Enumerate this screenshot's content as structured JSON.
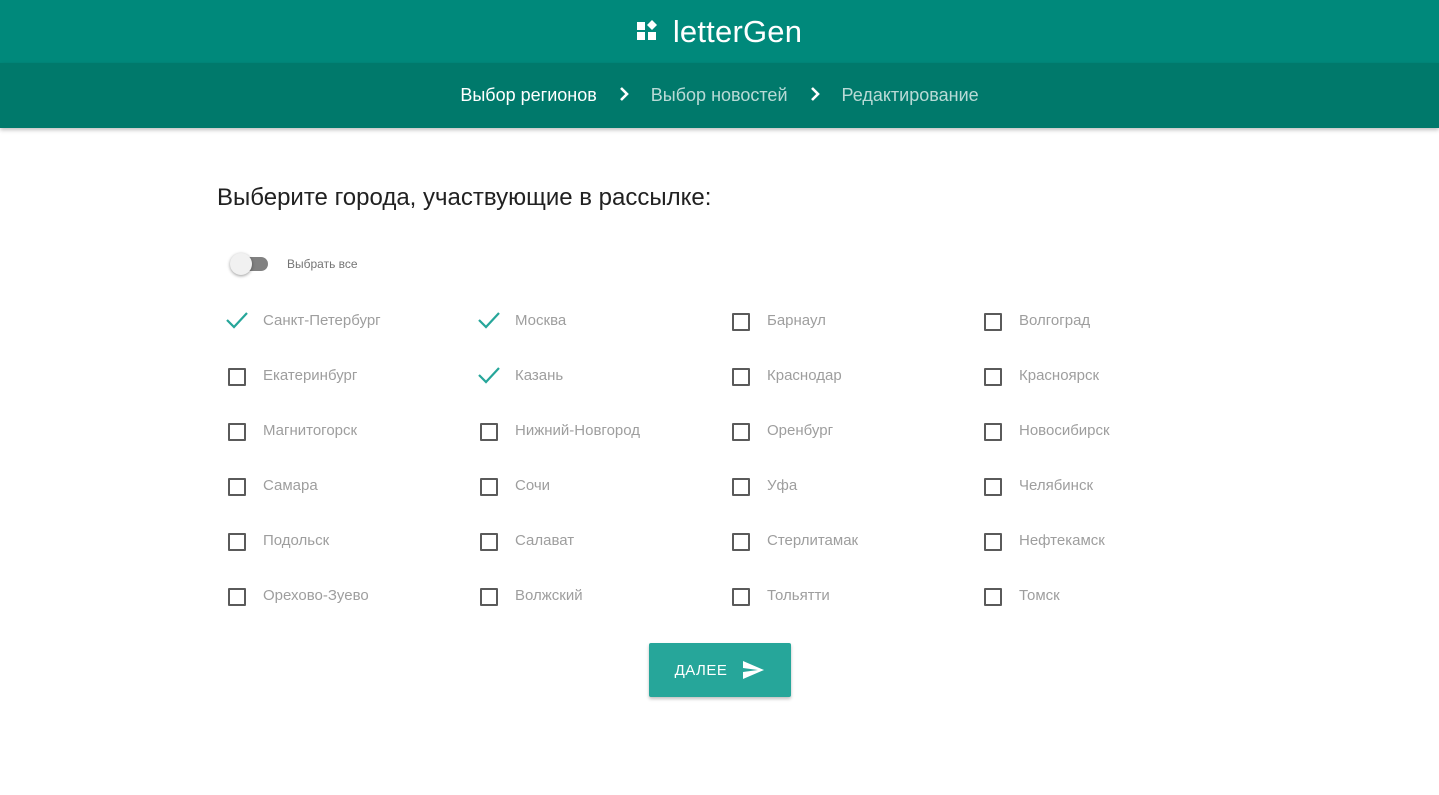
{
  "app": {
    "title": "letterGen",
    "logo_icon": "widgets-icon"
  },
  "colors": {
    "header": "#00897b",
    "stepper": "#00796b",
    "accent": "#26a69a",
    "check": "#26a69a"
  },
  "stepper": {
    "steps": [
      {
        "label": "Выбор регионов",
        "active": true
      },
      {
        "label": "Выбор новостей",
        "active": false
      },
      {
        "label": "Редактирование",
        "active": false
      }
    ],
    "separator_icon": "chevron-right-icon"
  },
  "main": {
    "title": "Выберите города, участвующие в рассылке:",
    "select_all": {
      "label": "Выбрать все",
      "on": false
    },
    "cities": [
      {
        "name": "Санкт-Петербург",
        "checked": true
      },
      {
        "name": "Москва",
        "checked": true
      },
      {
        "name": "Барнаул",
        "checked": false
      },
      {
        "name": "Волгоград",
        "checked": false
      },
      {
        "name": "Екатеринбург",
        "checked": false
      },
      {
        "name": "Казань",
        "checked": true
      },
      {
        "name": "Краснодар",
        "checked": false
      },
      {
        "name": "Красноярск",
        "checked": false
      },
      {
        "name": "Магнитогорск",
        "checked": false
      },
      {
        "name": "Нижний-Новгород",
        "checked": false
      },
      {
        "name": "Оренбург",
        "checked": false
      },
      {
        "name": "Новосибирск",
        "checked": false
      },
      {
        "name": "Самара",
        "checked": false
      },
      {
        "name": "Сочи",
        "checked": false
      },
      {
        "name": "Уфа",
        "checked": false
      },
      {
        "name": "Челябинск",
        "checked": false
      },
      {
        "name": "Подольск",
        "checked": false
      },
      {
        "name": "Салават",
        "checked": false
      },
      {
        "name": "Стерлитамак",
        "checked": false
      },
      {
        "name": "Нефтекамск",
        "checked": false
      },
      {
        "name": "Орехово-Зуево",
        "checked": false
      },
      {
        "name": "Волжский",
        "checked": false
      },
      {
        "name": "Тольятти",
        "checked": false
      },
      {
        "name": "Томск",
        "checked": false
      }
    ],
    "next_button": {
      "label": "ДАЛЕЕ",
      "icon": "send-icon"
    }
  }
}
